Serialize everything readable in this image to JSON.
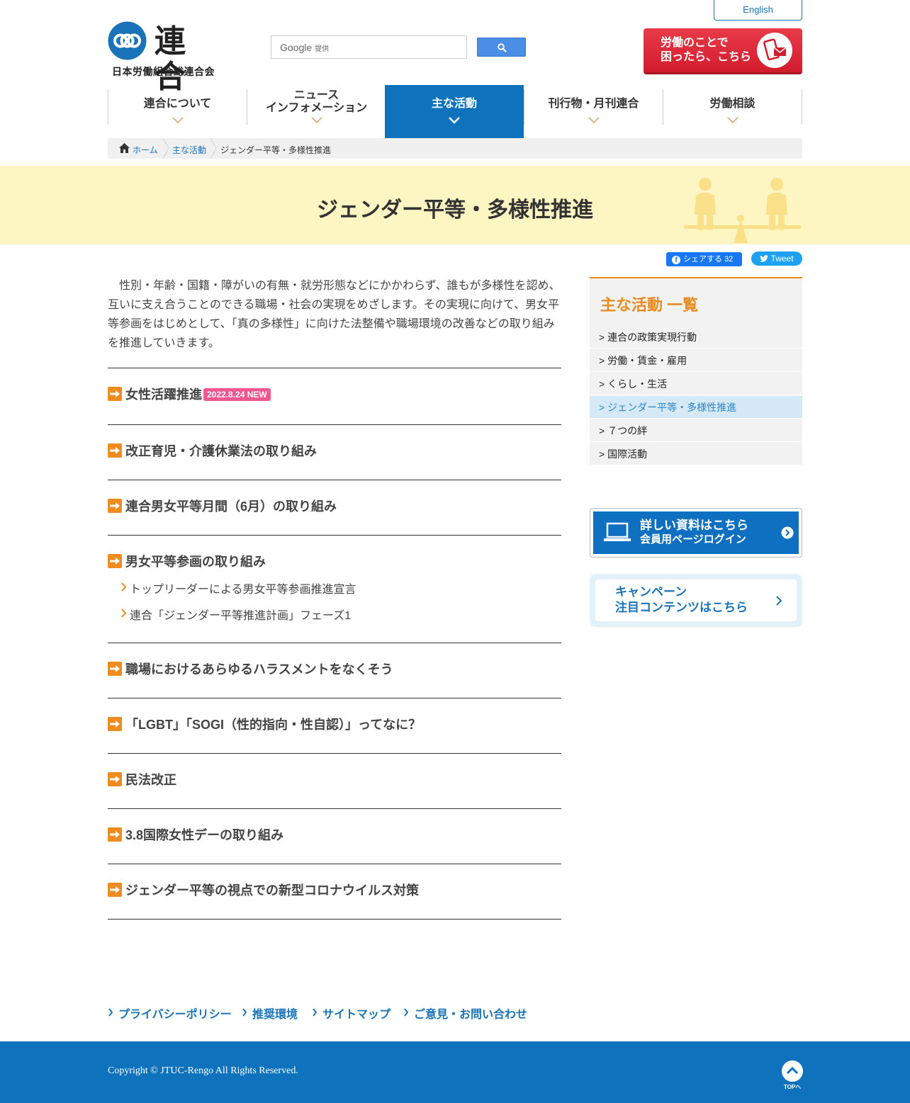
{
  "header": {
    "english_label": "English",
    "logo_kanji": "連合",
    "logo_sub": "日本労働組合総連合会",
    "search_brand": "Google",
    "search_brand_suffix": "提供",
    "consult_line1": "労働のことで",
    "consult_line2": "困ったら、こちら"
  },
  "nav": {
    "items": [
      {
        "label": "連合について"
      },
      {
        "label_line1": "ニュース",
        "label_line2": "インフォメーション"
      },
      {
        "label": "主な活動"
      },
      {
        "label": "刊行物・月刊連合"
      },
      {
        "label": "労働相談"
      }
    ]
  },
  "breadcrumb": {
    "home": "ホーム",
    "parent": "主な活動",
    "current": "ジェンダー平等・多様性推進"
  },
  "page": {
    "title": "ジェンダー平等・多様性推進",
    "intro": "性別・年齢・国籍・障がいの有無・就労形態などにかかわらず、誰もが多様性を認め、互いに支え合うことのできる職場・社会の実現をめざします。その実現に向けて、男女平等参画をはじめとして、「真の多様性」に向けた法整備や職場環境の改善などの取り組みを推進していきます。"
  },
  "share": {
    "fb_label": "シェアする",
    "fb_count": "32",
    "tweet_label": "Tweet"
  },
  "topics": [
    {
      "title": "女性活躍推進",
      "badge": "2022.8.24 NEW"
    },
    {
      "title": "改正育児・介護休業法の取り組み"
    },
    {
      "title": "連合男女平等月間（6月）の取り組み"
    },
    {
      "title": "男女平等参画の取り組み",
      "subs": [
        "トップリーダーによる男女平等参画推進宣言",
        "連合「ジェンダー平等推進計画」フェーズ1"
      ]
    },
    {
      "title": "職場におけるあらゆるハラスメントをなくそう"
    },
    {
      "title": "「LGBT」「SOGI（性的指向・性自認）」ってなに？"
    },
    {
      "title": "民法改正"
    },
    {
      "title": "3.8国際女性デーの取り組み"
    },
    {
      "title": "ジェンダー平等の視点での新型コロナウイルス対策"
    }
  ],
  "sidebar": {
    "title": "主な活動 一覧",
    "items": [
      {
        "label": "> 連合の政策実現行動"
      },
      {
        "label": "> 労働・賃金・雇用"
      },
      {
        "label": "> くらし・生活"
      },
      {
        "label": "> ジェンダー平等・多様性推進"
      },
      {
        "label": "> ７つの絆"
      },
      {
        "label": "> 国際活動"
      }
    ],
    "member_line1": "詳しい資料はこちら",
    "member_line2": "会員用ページログイン",
    "campaign_line1": "キャンペーン",
    "campaign_line2": "注目コンテンツはこちら"
  },
  "footer": {
    "links": [
      "プライバシーポリシー",
      "推奨環境",
      "サイトマップ",
      "ご意見・お問い合わせ"
    ],
    "copyright": "Copyright © JTUC-Rengo All Rights Reserved.",
    "top_label": "TOPへ"
  },
  "colors": {
    "brand_blue": "#0f72bd",
    "accent_orange": "#e88a1c",
    "title_band": "#fdf5c2",
    "new_badge": "#f0568f",
    "consult_red": "#e83a48"
  }
}
